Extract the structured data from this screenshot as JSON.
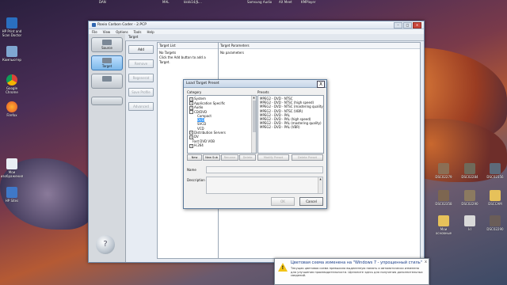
{
  "desktop": {
    "top_labels": [
      "DAN",
      "MAL",
      "kkkk14/JL...",
      "Samsung\nAudio",
      "AX Meet",
      "KMPlayer"
    ],
    "left_icons": [
      "HP Print and Scan Doctor",
      "Компьютер",
      "Google Chrome",
      "Firefox",
      "Мои изображения",
      "HP Sites"
    ],
    "right_icons": [
      "DSC02279",
      "DSC02284",
      "DSC02356",
      "DSC02358",
      "DSC02290",
      "DSCCAM",
      "DSC02290",
      "DSC02290",
      "kl",
      "Мои основные",
      "DSC02290"
    ]
  },
  "app": {
    "title": "Roxio Carbon Coder - 2.PCP",
    "menu": [
      "File",
      "View",
      "Options",
      "Tools",
      "Help"
    ],
    "window_buttons": [
      "–",
      "□",
      "✕"
    ],
    "sidebar": {
      "source_label": "Source",
      "target_label": "Target",
      "convert_label": "",
      "help_glyph": "?"
    },
    "toolstrip_label": "Target",
    "actions": {
      "add": "Add",
      "remove": "Remove",
      "regenerate": "Regenerat",
      "save_profile": "Save Profile",
      "advanced": "Advanced"
    },
    "target_list": {
      "header": "Target List",
      "line1": "No Targets",
      "line2": "Click the Add button to add a Target."
    },
    "target_params": {
      "header": "Target Parameters",
      "line1": "No parameters"
    }
  },
  "dialog": {
    "title": "Load Target Preset",
    "close": "X",
    "category_label": "Category",
    "presets_label": "Presets",
    "categories": [
      {
        "label": "System",
        "indent": 0,
        "toggle": "+"
      },
      {
        "label": "Application Specific",
        "indent": 0,
        "toggle": "+"
      },
      {
        "label": "Audio",
        "indent": 0,
        "toggle": "+"
      },
      {
        "label": "CD/DVD",
        "indent": 0,
        "toggle": "-"
      },
      {
        "label": "Compact",
        "indent": 1,
        "toggle": ""
      },
      {
        "label": "DVD",
        "indent": 1,
        "toggle": "",
        "selected": true
      },
      {
        "label": "SVCD",
        "indent": 1,
        "toggle": ""
      },
      {
        "label": "VCD",
        "indent": 1,
        "toggle": ""
      },
      {
        "label": "Distribution Servers",
        "indent": 0,
        "toggle": "+"
      },
      {
        "label": "DV",
        "indent": 0,
        "toggle": "+"
      },
      {
        "label": "Fast DVD VOB",
        "indent": 0,
        "toggle": ""
      },
      {
        "label": "H.264",
        "indent": 0,
        "toggle": "+"
      }
    ],
    "presets": [
      "MPEG2 - DVD - NTSC",
      "MPEG2 - DVD - NTSC (high speed)",
      "MPEG2 - DVD - NTSC (mastering quality)",
      "MPEG2 - DVD - NTSC (VBR)",
      "MPEG2 - DVD - PAL",
      "MPEG2 - DVD - PAL (high speed)",
      "MPEG2 - DVD - PAL (mastering quality)",
      "MPEG2 - DVD - PAL (VBR)"
    ],
    "category_buttons": [
      "New",
      "New Sub",
      "Rename",
      "Delete"
    ],
    "preset_buttons": [
      "Modify Preset",
      "Delete Preset"
    ],
    "name_label": "Name",
    "description_label": "Description",
    "ok": "OK",
    "cancel": "Cancel"
  },
  "notification": {
    "title": "Цветовая схема изменена на \"Windows 7 - упрощенный стиль\"",
    "body": "Текущая цветовая схема превысила выделенную память и автоматически изменена для улучшения производительности. Щелкните здесь для получения дополнительных сведений.",
    "close": "x"
  }
}
